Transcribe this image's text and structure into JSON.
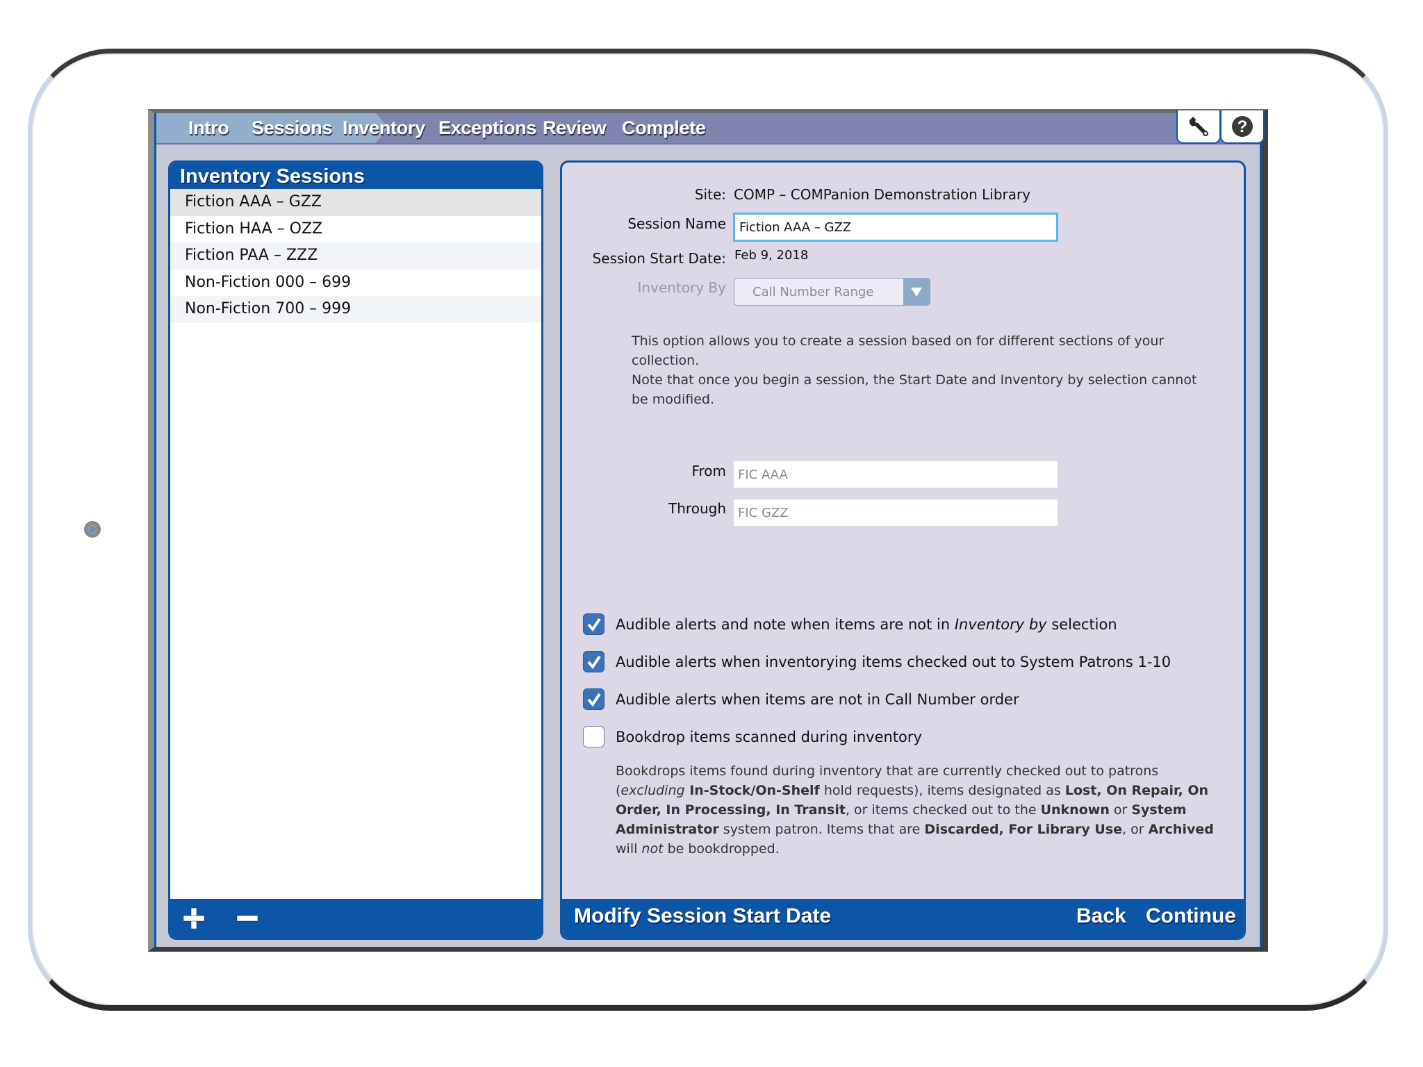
{
  "nav": {
    "steps": [
      {
        "label": "Intro",
        "state": "done"
      },
      {
        "label": "Sessions",
        "state": "current"
      },
      {
        "label": "Inventory",
        "state": "pending"
      },
      {
        "label": "Exceptions",
        "state": "pending"
      },
      {
        "label": "Review",
        "state": "pending"
      },
      {
        "label": "Complete",
        "state": "pending"
      }
    ],
    "tools": [
      {
        "name": "wrench-icon",
        "label": "Settings"
      },
      {
        "name": "help-icon",
        "label": "Help"
      }
    ]
  },
  "sessions_panel": {
    "title": "Inventory Sessions",
    "items": [
      {
        "label": "Fiction AAA – GZZ",
        "selected": true
      },
      {
        "label": "Fiction HAA – OZZ",
        "selected": false
      },
      {
        "label": "Fiction PAA – ZZZ",
        "selected": false
      },
      {
        "label": "Non-Fiction 000 – 699",
        "selected": false
      },
      {
        "label": "Non-Fiction 700 – 999",
        "selected": false
      }
    ],
    "add_icon": "plus-icon",
    "remove_icon": "minus-icon"
  },
  "details": {
    "site_label": "Site:",
    "site_value": "COMP – COMPanion Demonstration Library",
    "session_name_label": "Session Name",
    "session_name_value": "Fiction AAA – GZZ",
    "start_date_label": "Session Start Date:",
    "start_date_value": "Feb 9, 2018",
    "inventory_by_label": "Inventory By",
    "inventory_by_value": "Call Number Range",
    "description_line1": "This option allows you to create a session based on for different sections of your collection.",
    "description_line2": "Note that once you begin a session, the Start Date and Inventory by selection cannot be modified.",
    "from_label": "From",
    "from_value": "FIC AAA",
    "through_label": "Through",
    "through_value": "FIC GZZ",
    "options": [
      {
        "pre": "Audible alerts and note when items are not in ",
        "em": "Inventory by",
        "post": " selection",
        "checked": true
      },
      {
        "pre": "Audible alerts when inventorying items checked out to System Patrons 1-10",
        "em": "",
        "post": "",
        "checked": true
      },
      {
        "pre": "Audible alerts when items are not in Call Number order",
        "em": "",
        "post": "",
        "checked": true
      },
      {
        "pre": "Bookdrop items scanned during inventory",
        "em": "",
        "post": "",
        "checked": false
      }
    ],
    "bookdrop_desc": {
      "t1": "Bookdrops items found during inventory that are currently checked out to patrons (",
      "i1": "excluding",
      "b1": " In-Stock/On-Shelf",
      "t2": " hold requests), items designated as ",
      "b2": "Lost, On Repair, On Order, In Processing, In Transit",
      "t3": ", or items checked out to the ",
      "b3": "Unknown",
      "t4": " or ",
      "b4": "System Administrator",
      "t5": " system patron. Items that are ",
      "b5": "Discarded, For Library Use",
      "t6": ", or ",
      "b6": "Archived",
      "t7": " will ",
      "i2": "not",
      "t8": " be bookdropped."
    }
  },
  "footer": {
    "modify_label": "Modify Session Start Date",
    "back_label": "Back",
    "continue_label": "Continue"
  },
  "colors": {
    "accent_blue": "#0d55a6",
    "nav_bg": "#8085b0",
    "nav_done": "#93aecb",
    "panel_bg": "#dcd8e8",
    "focus_ring": "#55b8e6",
    "checkbox_on": "#3b72b8"
  }
}
